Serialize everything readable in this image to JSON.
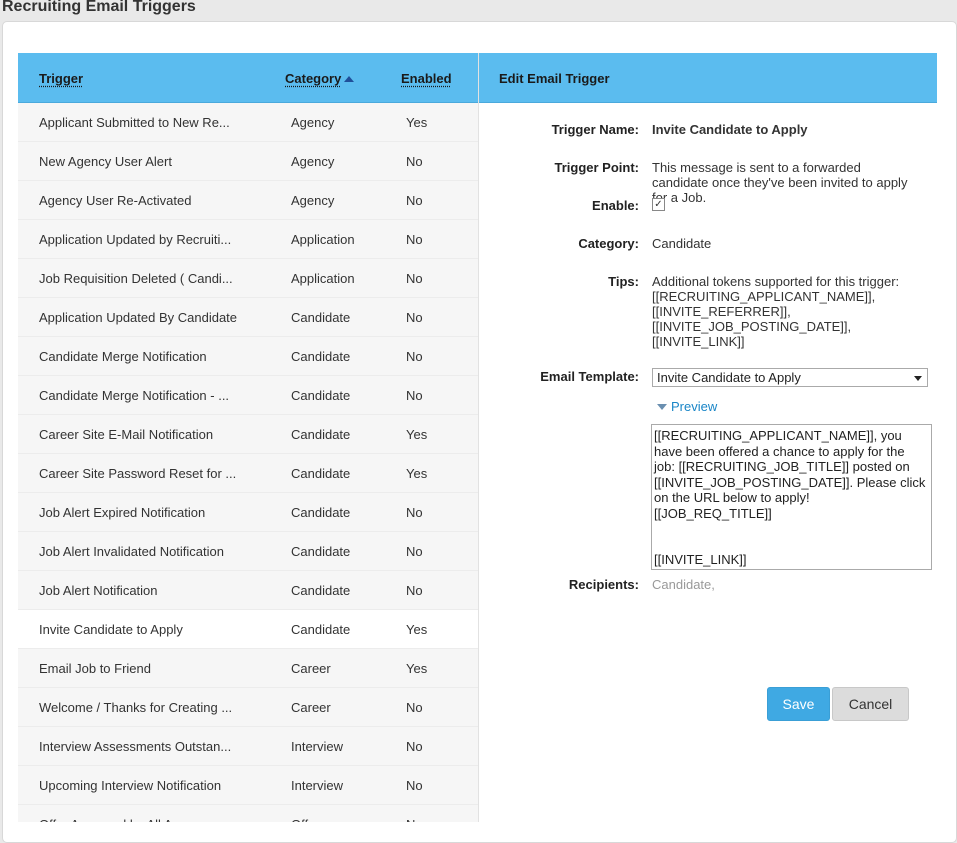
{
  "page": {
    "title": "Recruiting Email Triggers"
  },
  "list": {
    "headers": {
      "trigger": "Trigger",
      "category": "Category",
      "enabled": "Enabled"
    },
    "rows": [
      {
        "trigger": "Applicant Submitted to New Re...",
        "category": "Agency",
        "enabled": "Yes"
      },
      {
        "trigger": "New Agency User Alert",
        "category": "Agency",
        "enabled": "No"
      },
      {
        "trigger": "Agency User Re-Activated",
        "category": "Agency",
        "enabled": "No"
      },
      {
        "trigger": "Application Updated by Recruiti...",
        "category": "Application",
        "enabled": "No"
      },
      {
        "trigger": "Job Requisition Deleted ( Candi...",
        "category": "Application",
        "enabled": "No"
      },
      {
        "trigger": "Application Updated By Candidate",
        "category": "Candidate",
        "enabled": "No"
      },
      {
        "trigger": "Candidate Merge Notification",
        "category": "Candidate",
        "enabled": "No"
      },
      {
        "trigger": "Candidate Merge Notification - ...",
        "category": "Candidate",
        "enabled": "No"
      },
      {
        "trigger": "Career Site E-Mail Notification",
        "category": "Candidate",
        "enabled": "Yes"
      },
      {
        "trigger": "Career Site Password Reset for ...",
        "category": "Candidate",
        "enabled": "Yes"
      },
      {
        "trigger": "Job Alert Expired Notification",
        "category": "Candidate",
        "enabled": "No"
      },
      {
        "trigger": "Job Alert Invalidated Notification",
        "category": "Candidate",
        "enabled": "No"
      },
      {
        "trigger": "Job Alert Notification",
        "category": "Candidate",
        "enabled": "No"
      },
      {
        "trigger": "Invite Candidate to Apply",
        "category": "Candidate",
        "enabled": "Yes",
        "selected": true
      },
      {
        "trigger": "Email Job to Friend",
        "category": "Career",
        "enabled": "Yes"
      },
      {
        "trigger": "Welcome / Thanks for Creating ...",
        "category": "Career",
        "enabled": "No"
      },
      {
        "trigger": "Interview Assessments Outstan...",
        "category": "Interview",
        "enabled": "No"
      },
      {
        "trigger": "Upcoming Interview Notification",
        "category": "Interview",
        "enabled": "No"
      },
      {
        "trigger": "Offer Approved by All Approvers",
        "category": "Offer",
        "enabled": "No"
      }
    ]
  },
  "editor": {
    "title": "Edit Email Trigger",
    "labels": {
      "trigger_name": "Trigger Name:",
      "trigger_point": "Trigger Point:",
      "enable": "Enable:",
      "category": "Category:",
      "tips": "Tips:",
      "email_template": "Email Template:",
      "recipients": "Recipients:"
    },
    "trigger_name": "Invite Candidate to Apply",
    "trigger_point": "This message is sent to a forwarded candidate once they've been invited to apply for a Job.",
    "enabled_check": "✓",
    "category": "Candidate",
    "tips": "Additional tokens supported for this trigger:\n[[RECRUITING_APPLICANT_NAME]],\n[[INVITE_REFERRER]],\n[[INVITE_JOB_POSTING_DATE]],\n[[INVITE_LINK]]",
    "email_template": "Invite Candidate to Apply",
    "preview_label": "Preview",
    "template_body": "[[RECRUITING_APPLICANT_NAME]], you have been offered a chance to apply for the job: [[RECRUITING_JOB_TITLE]] posted on [[INVITE_JOB_POSTING_DATE]]. Please click on the URL below to apply!\n[[JOB_REQ_TITLE]]\n\n\n[[INVITE_LINK]]",
    "recipients": "Candidate,",
    "save_label": "Save",
    "cancel_label": "Cancel"
  }
}
